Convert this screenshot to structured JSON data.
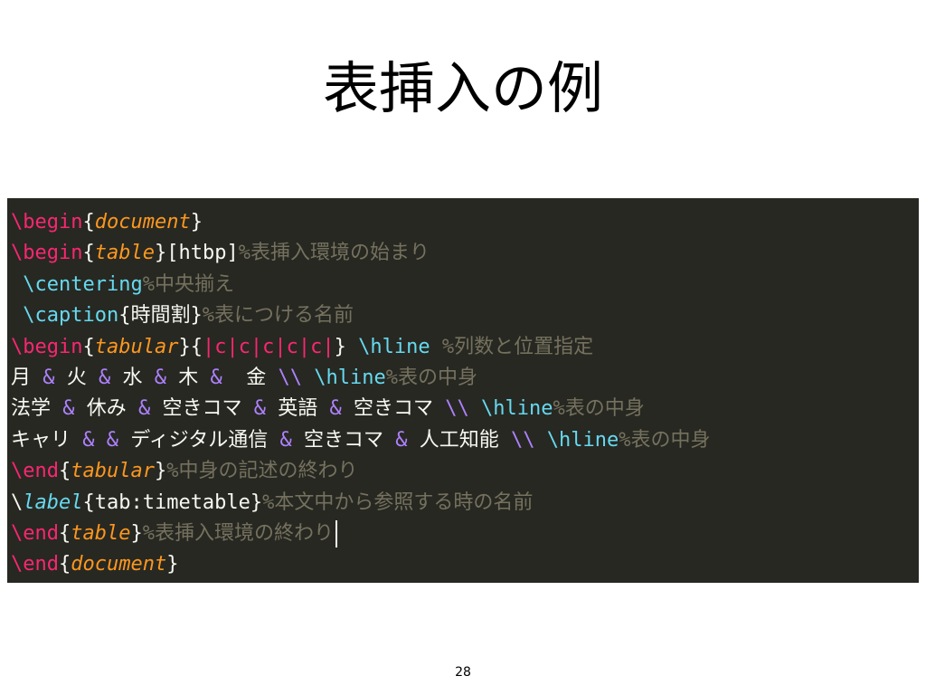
{
  "slide": {
    "title": "表挿入の例",
    "page_number": "28"
  },
  "colors": {
    "background": "#ffffff",
    "editor_background": "#272822",
    "command": "#f92672",
    "command_alt": "#66d9ef",
    "environment": "#fd971f",
    "text": "#f8f8f2",
    "comment": "#75715e",
    "ampersand": "#ae81ff"
  },
  "code": {
    "lines": [
      [
        {
          "text": "\\begin",
          "type": "cmd"
        },
        {
          "text": "{",
          "type": "brace"
        },
        {
          "text": "document",
          "type": "env"
        },
        {
          "text": "}",
          "type": "brace"
        }
      ],
      [
        {
          "text": "\\begin",
          "type": "cmd"
        },
        {
          "text": "{",
          "type": "brace"
        },
        {
          "text": "table",
          "type": "env"
        },
        {
          "text": "}",
          "type": "brace"
        },
        {
          "text": "[htbp]",
          "type": "text"
        },
        {
          "text": "%表挿入環境の始まり",
          "type": "comment"
        }
      ],
      [
        {
          "text": " \\centering",
          "type": "cmd2"
        },
        {
          "text": "%中央揃え",
          "type": "comment"
        }
      ],
      [
        {
          "text": " \\caption",
          "type": "cmd2"
        },
        {
          "text": "{時間割}",
          "type": "text"
        },
        {
          "text": "%表につける名前",
          "type": "comment"
        }
      ],
      [
        {
          "text": "\\begin",
          "type": "cmd"
        },
        {
          "text": "{",
          "type": "brace"
        },
        {
          "text": "tabular",
          "type": "env"
        },
        {
          "text": "}",
          "type": "brace"
        },
        {
          "text": "{",
          "type": "brace"
        },
        {
          "text": "|c|c|c|c|c|",
          "type": "col"
        },
        {
          "text": "}",
          "type": "brace"
        },
        {
          "text": " \\hline",
          "type": "cmd2"
        },
        {
          "text": " %列数と位置指定",
          "type": "comment"
        }
      ],
      [
        {
          "text": "月 ",
          "type": "text"
        },
        {
          "text": "&",
          "type": "amp"
        },
        {
          "text": " 火 ",
          "type": "text"
        },
        {
          "text": "&",
          "type": "amp"
        },
        {
          "text": " 水 ",
          "type": "text"
        },
        {
          "text": "&",
          "type": "amp"
        },
        {
          "text": " 木 ",
          "type": "text"
        },
        {
          "text": "&",
          "type": "amp"
        },
        {
          "text": "  金 ",
          "type": "text"
        },
        {
          "text": "\\\\",
          "type": "amp"
        },
        {
          "text": " \\hline",
          "type": "cmd2"
        },
        {
          "text": "%表の中身",
          "type": "comment"
        }
      ],
      [
        {
          "text": "法学 ",
          "type": "text"
        },
        {
          "text": "&",
          "type": "amp"
        },
        {
          "text": " 休み ",
          "type": "text"
        },
        {
          "text": "&",
          "type": "amp"
        },
        {
          "text": " 空きコマ ",
          "type": "text"
        },
        {
          "text": "&",
          "type": "amp"
        },
        {
          "text": " 英語 ",
          "type": "text"
        },
        {
          "text": "&",
          "type": "amp"
        },
        {
          "text": " 空きコマ ",
          "type": "text"
        },
        {
          "text": "\\\\",
          "type": "amp"
        },
        {
          "text": " \\hline",
          "type": "cmd2"
        },
        {
          "text": "%表の中身",
          "type": "comment"
        }
      ],
      [
        {
          "text": "キャリ ",
          "type": "text"
        },
        {
          "text": "&",
          "type": "amp"
        },
        {
          "text": " ",
          "type": "text"
        },
        {
          "text": "&",
          "type": "amp"
        },
        {
          "text": " ディジタル通信 ",
          "type": "text"
        },
        {
          "text": "&",
          "type": "amp"
        },
        {
          "text": " 空きコマ ",
          "type": "text"
        },
        {
          "text": "&",
          "type": "amp"
        },
        {
          "text": " 人工知能 ",
          "type": "text"
        },
        {
          "text": "\\\\",
          "type": "amp"
        },
        {
          "text": " \\hline",
          "type": "cmd2"
        },
        {
          "text": "%表の中身",
          "type": "comment"
        }
      ],
      [
        {
          "text": "\\end",
          "type": "cmd"
        },
        {
          "text": "{",
          "type": "brace"
        },
        {
          "text": "tabular",
          "type": "env"
        },
        {
          "text": "}",
          "type": "brace"
        },
        {
          "text": "%中身の記述の終わり",
          "type": "comment"
        }
      ],
      [
        {
          "text": "\\",
          "type": "text"
        },
        {
          "text": "label",
          "type": "env2"
        },
        {
          "text": "{tab:timetable}",
          "type": "text"
        },
        {
          "text": "%本文中から参照する時の名前",
          "type": "comment"
        }
      ],
      [
        {
          "text": "\\end",
          "type": "cmd"
        },
        {
          "text": "{",
          "type": "brace"
        },
        {
          "text": "table",
          "type": "env"
        },
        {
          "text": "}",
          "type": "brace"
        },
        {
          "text": "%表挿入環境の終わり",
          "type": "comment"
        }
      ],
      [
        {
          "text": "\\end",
          "type": "cmd"
        },
        {
          "text": "{",
          "type": "brace"
        },
        {
          "text": "document",
          "type": "env"
        },
        {
          "text": "}",
          "type": "brace"
        }
      ]
    ],
    "cursor_line": 10
  }
}
